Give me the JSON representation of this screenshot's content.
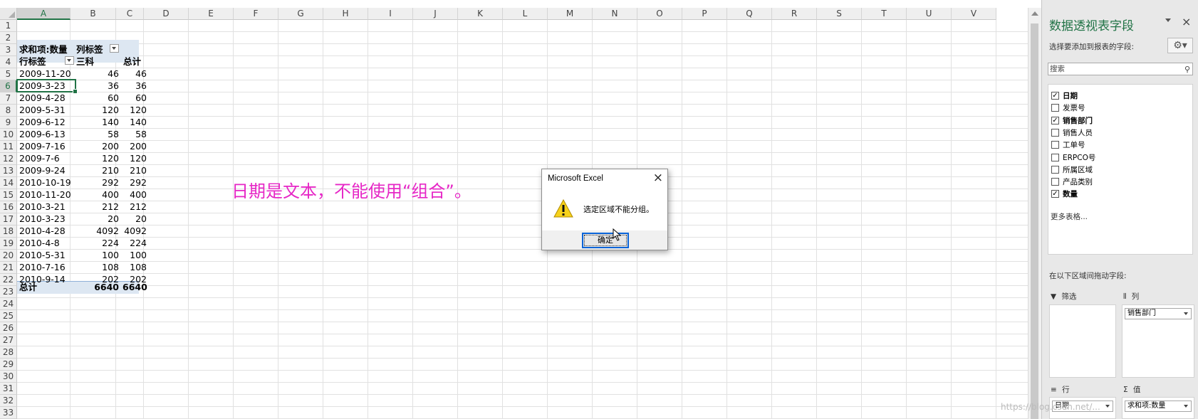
{
  "sheet": {
    "columns": [
      "A",
      "B",
      "C",
      "D",
      "E",
      "F",
      "G",
      "H",
      "I",
      "J",
      "K",
      "L",
      "M",
      "N",
      "O",
      "P",
      "Q",
      "R",
      "S",
      "T",
      "U",
      "V"
    ],
    "rows": [
      "1",
      "2",
      "3",
      "4",
      "5",
      "6",
      "7",
      "8",
      "9",
      "10",
      "11",
      "12",
      "13",
      "14",
      "15",
      "16",
      "17",
      "18",
      "19",
      "20",
      "21",
      "22",
      "23",
      "24",
      "25",
      "26",
      "27",
      "28",
      "29",
      "30",
      "31",
      "32",
      "33"
    ],
    "selected_column": "A",
    "selected_row": "6"
  },
  "pivot": {
    "header1": {
      "sum_label": "求和项:数量",
      "col_label": "列标签"
    },
    "header2": {
      "row_label": "行标签",
      "col_name": "三科",
      "total_label": "总计"
    },
    "rows": [
      {
        "date": "2009-11-20",
        "v1": "46",
        "v2": "46"
      },
      {
        "date": "2009-3-23",
        "v1": "36",
        "v2": "36"
      },
      {
        "date": "2009-4-28",
        "v1": "60",
        "v2": "60"
      },
      {
        "date": "2009-5-31",
        "v1": "120",
        "v2": "120"
      },
      {
        "date": "2009-6-12",
        "v1": "140",
        "v2": "140"
      },
      {
        "date": "2009-6-13",
        "v1": "58",
        "v2": "58"
      },
      {
        "date": "2009-7-16",
        "v1": "200",
        "v2": "200"
      },
      {
        "date": "2009-7-6",
        "v1": "120",
        "v2": "120"
      },
      {
        "date": "2009-9-24",
        "v1": "210",
        "v2": "210"
      },
      {
        "date": "2010-10-19",
        "v1": "292",
        "v2": "292"
      },
      {
        "date": "2010-11-20",
        "v1": "400",
        "v2": "400"
      },
      {
        "date": "2010-3-21",
        "v1": "212",
        "v2": "212"
      },
      {
        "date": "2010-3-23",
        "v1": "20",
        "v2": "20"
      },
      {
        "date": "2010-4-28",
        "v1": "4092",
        "v2": "4092"
      },
      {
        "date": "2010-4-8",
        "v1": "224",
        "v2": "224"
      },
      {
        "date": "2010-5-31",
        "v1": "100",
        "v2": "100"
      },
      {
        "date": "2010-7-16",
        "v1": "108",
        "v2": "108"
      },
      {
        "date": "2010-9-14",
        "v1": "202",
        "v2": "202"
      }
    ],
    "total": {
      "label": "总计",
      "v1": "6640",
      "v2": "6640"
    }
  },
  "annotation": "日期是文本，不能使用“组合”。",
  "dialog": {
    "title": "Microsoft Excel",
    "close_icon": "×",
    "message": "选定区域不能分组。",
    "ok_label": "确定"
  },
  "panel": {
    "title": "数据透视表字段",
    "close_icon": "×",
    "subtitle": "选择要添加到报表的字段:",
    "gear_icon": "⚙▾",
    "search_placeholder": "搜索",
    "search_icon": "⚲",
    "fields": [
      {
        "label": "日期",
        "checked": true,
        "mark": "✓"
      },
      {
        "label": "发票号",
        "checked": false,
        "mark": ""
      },
      {
        "label": "销售部门",
        "checked": true,
        "mark": "✓"
      },
      {
        "label": "销售人员",
        "checked": false,
        "mark": ""
      },
      {
        "label": "工单号",
        "checked": false,
        "mark": ""
      },
      {
        "label": "ERPCO号",
        "checked": false,
        "mark": ""
      },
      {
        "label": "所属区域",
        "checked": false,
        "mark": ""
      },
      {
        "label": "产品类别",
        "checked": false,
        "mark": ""
      },
      {
        "label": "数量",
        "checked": true,
        "mark": "✓"
      }
    ],
    "more_tables": "更多表格...",
    "drag_note": "在以下区域间拖动字段:",
    "areas": {
      "filter": {
        "icon": "▼",
        "label": "筛选"
      },
      "columns": {
        "icon": "⫴",
        "label": "列",
        "item": "销售部门"
      },
      "rows": {
        "icon": "≡",
        "label": "行",
        "item": "日期"
      },
      "values": {
        "icon": "Σ",
        "label": "值",
        "item": "求和项:数量"
      }
    }
  },
  "watermark": "https://blog.csdn.net/..."
}
